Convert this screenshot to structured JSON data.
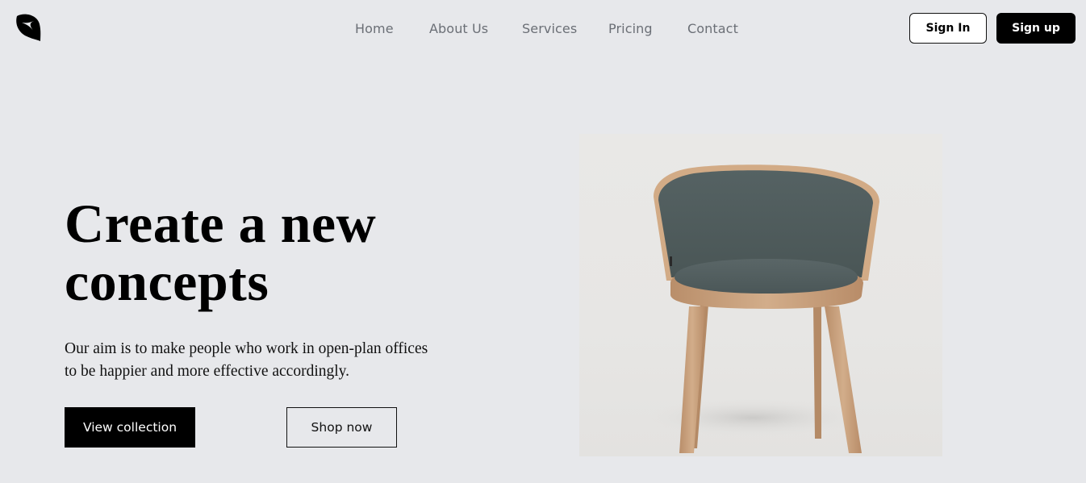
{
  "header": {
    "logo_icon": "leaf-bird-logo-icon",
    "nav": [
      {
        "label": "Home"
      },
      {
        "label": "About Us"
      },
      {
        "label": "Services"
      },
      {
        "label": "Pricing"
      },
      {
        "label": "Contact"
      }
    ],
    "signin_label": "Sign In",
    "signup_label": "Sign up"
  },
  "hero": {
    "title_line1": "Create a new",
    "title_line2": "concepts",
    "subtitle_line1": "Our aim is to make people who work in open-plan offices",
    "subtitle_line2": "to be happier and more effective accordingly.",
    "primary_cta": "View collection",
    "secondary_cta": "Shop now",
    "image_subject": "upholstered-chair-with-wooden-legs"
  },
  "colors": {
    "background": "#e7e8eb",
    "primary": "#000000",
    "nav_text": "#6b6f76",
    "chair_fabric": "#4f5c5c",
    "chair_wood": "#c9a27f"
  }
}
